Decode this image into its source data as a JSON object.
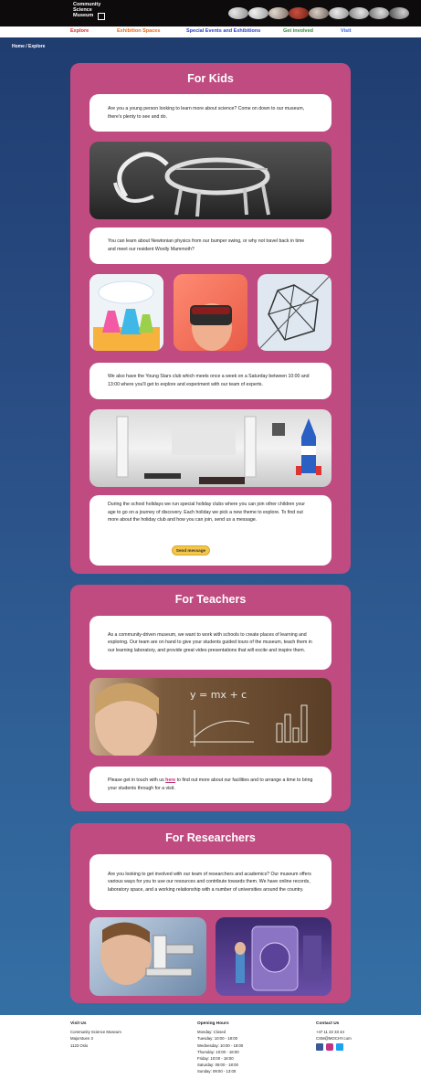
{
  "header": {
    "logo_lines": [
      "Community",
      "Science",
      "Museum"
    ]
  },
  "nav": {
    "items": [
      {
        "label": "Explore",
        "color": "#e2282d"
      },
      {
        "label": "Exhibition Spaces",
        "color": "#e86a17"
      },
      {
        "label": "Special Events and Exhibitions",
        "color": "#2a3fc9"
      },
      {
        "label": "Get involved",
        "color": "#2d8a35"
      },
      {
        "label": "Visit",
        "color": "#3a63d8"
      }
    ]
  },
  "breadcrumb": "Home / Explore",
  "kids": {
    "title": "For Kids",
    "intro": "Are you a young person looking to learn more about science? Come on down to our museum, there's plenty to see and do.",
    "physics": "You can learn about Newtonian physics from our bumper swing, or why not travel back in time and meet our resident Woolly Mammoth?",
    "young_stars": "We also have the Young Stars club which meets once a week on a Saturday between 10:00 and 13:00 where you'll get to explore and experiment with our team of experts.",
    "holiday": "During the school holidays we run special holiday clubs where you can join other children your age to go on a journey of discovery. Each holiday we pick a new theme to explore. To find out more about the holiday club and how you can join, send us a message.",
    "button": "Send message"
  },
  "teachers": {
    "title": "For Teachers",
    "intro": "As a community-driven museum, we want to work with schools to create places of learning and exploring. Our team are on hand to give your students guided tours of the museum, teach them in our learning laboratory, and provide great video presentations that will excite and inspire them.",
    "contact_before": "Please get in touch with us ",
    "contact_link": "here",
    "contact_after": " to find out more about our facilities and to arrange a time to bring your students through for a visit.",
    "board_text": "y = mx + c"
  },
  "researchers": {
    "title": "For Researchers",
    "intro": "Are you looking to get involved with our team of researchers and academics? Our museum offers various ways for you to use our resources and contribute towards them. We have online records, laboratory space, and a working relationship with a number of universities around the country."
  },
  "footer": {
    "visit": {
      "heading": "Visit Us",
      "lines": [
        "Community Science Museum",
        "Majorstuen 3",
        "1123 Oslo"
      ]
    },
    "hours": {
      "heading": "Opening Hours",
      "lines": [
        "Monday: Closed",
        "Tuesday: 10:00 - 18:00",
        "Wednesday: 10:00 - 18:00",
        "Thursday: 10:00 - 18:00",
        "Friday: 10:00 - 18:00",
        "Saturday: 09:00 - 18:00",
        "Sunday: 09:00 - 13:00"
      ]
    },
    "contact": {
      "heading": "Contact Us",
      "lines": [
        "+47 11 22 33 44",
        "CSM@MOCHY.com"
      ],
      "social_icons": [
        "facebook-icon",
        "instagram-icon",
        "twitter-icon"
      ]
    }
  }
}
